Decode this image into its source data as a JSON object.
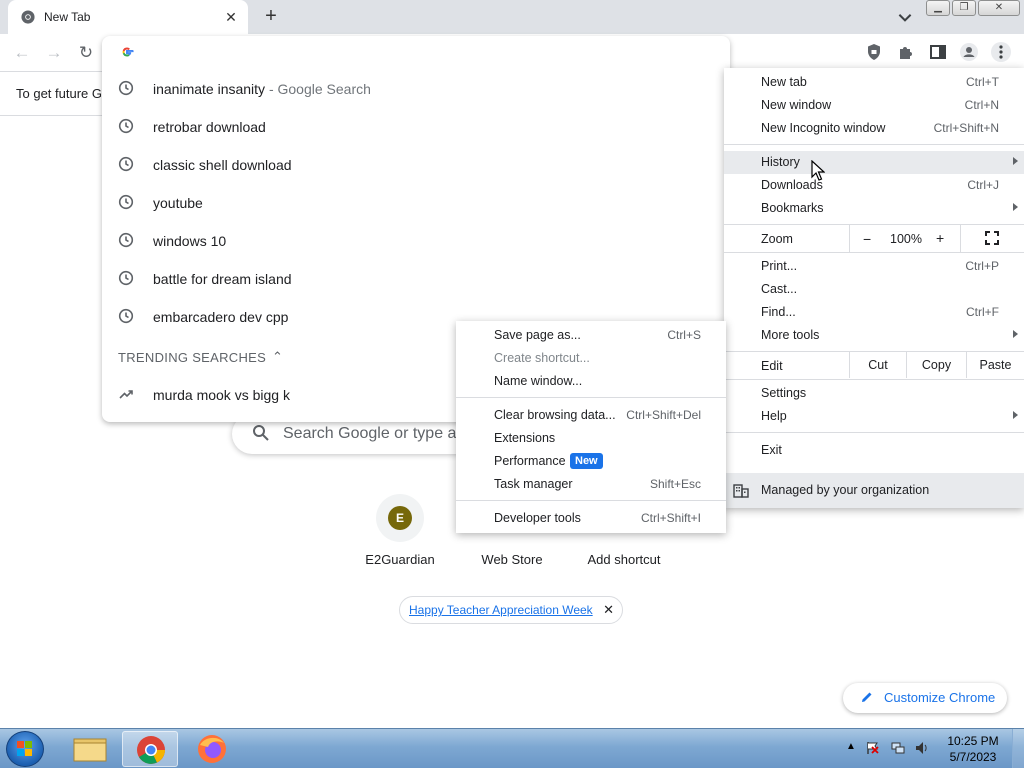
{
  "tab": {
    "title": "New Tab"
  },
  "omnibox": {
    "suggestions": [
      {
        "text": "inanimate insanity",
        "suffix": " - Google Search"
      },
      {
        "text": "retrobar download",
        "suffix": ""
      },
      {
        "text": "classic shell download",
        "suffix": ""
      },
      {
        "text": "youtube",
        "suffix": ""
      },
      {
        "text": "windows 10",
        "suffix": ""
      },
      {
        "text": "battle for dream island",
        "suffix": ""
      },
      {
        "text": "embarcadero dev cpp",
        "suffix": ""
      }
    ],
    "trending_header": "TRENDING SEARCHES",
    "trending": [
      {
        "text": "murda mook vs bigg k"
      }
    ]
  },
  "infobar": {
    "text": "To get future G"
  },
  "page": {
    "search_placeholder": "Search Google or type a",
    "shortcuts": [
      {
        "label": "E2Guardian",
        "initial": "E"
      },
      {
        "label": "Web Store"
      },
      {
        "label": "Add shortcut"
      }
    ],
    "promo_link": "Happy Teacher Appreciation Week",
    "customize": "Customize Chrome"
  },
  "menu": {
    "new_tab": {
      "label": "New tab",
      "shortcut": "Ctrl+T"
    },
    "new_window": {
      "label": "New window",
      "shortcut": "Ctrl+N"
    },
    "new_incognito": {
      "label": "New Incognito window",
      "shortcut": "Ctrl+Shift+N"
    },
    "history": {
      "label": "History"
    },
    "downloads": {
      "label": "Downloads",
      "shortcut": "Ctrl+J"
    },
    "bookmarks": {
      "label": "Bookmarks"
    },
    "zoom": {
      "label": "Zoom",
      "minus": "−",
      "value": "100%",
      "plus": "+"
    },
    "print": {
      "label": "Print...",
      "shortcut": "Ctrl+P"
    },
    "cast": {
      "label": "Cast..."
    },
    "find": {
      "label": "Find...",
      "shortcut": "Ctrl+F"
    },
    "more_tools": {
      "label": "More tools"
    },
    "edit": {
      "label": "Edit",
      "cut": "Cut",
      "copy": "Copy",
      "paste": "Paste"
    },
    "settings": {
      "label": "Settings"
    },
    "help": {
      "label": "Help"
    },
    "exit": {
      "label": "Exit"
    },
    "managed": {
      "label": "Managed by your organization"
    }
  },
  "submenu": {
    "save_page": {
      "label": "Save page as...",
      "shortcut": "Ctrl+S"
    },
    "create_shortcut": {
      "label": "Create shortcut..."
    },
    "name_window": {
      "label": "Name window..."
    },
    "clear_data": {
      "label": "Clear browsing data...",
      "shortcut": "Ctrl+Shift+Del"
    },
    "extensions": {
      "label": "Extensions"
    },
    "performance": {
      "label": "Performance",
      "badge": "New"
    },
    "task_manager": {
      "label": "Task manager",
      "shortcut": "Shift+Esc"
    },
    "dev_tools": {
      "label": "Developer tools",
      "shortcut": "Ctrl+Shift+I"
    }
  },
  "taskbar": {
    "time": "10:25 PM",
    "date": "5/7/2023"
  },
  "colors": {
    "accent": "#1a73e8",
    "tabbar": "#dee1e6",
    "menu_highlight": "#e8eaed"
  }
}
